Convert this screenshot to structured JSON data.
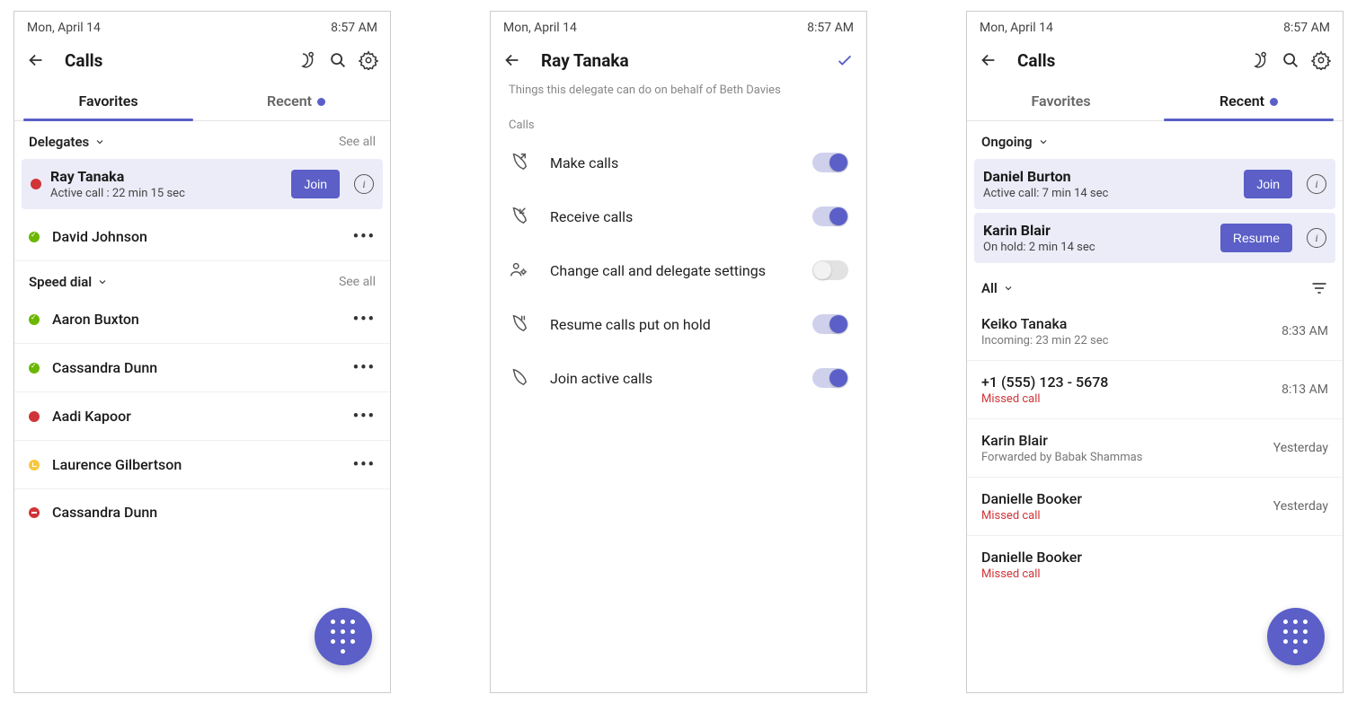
{
  "status": {
    "date": "Mon, April 14",
    "time": "8:57 AM"
  },
  "screen1": {
    "title": "Calls",
    "tabs": {
      "favorites": "Favorites",
      "recent": "Recent"
    },
    "sections": {
      "delegates": "Delegates",
      "speed_dial": "Speed dial",
      "see_all": "See all"
    },
    "active_call": {
      "name": "Ray Tanaka",
      "status": "Active call : 22 min 15 sec",
      "join": "Join"
    },
    "list": {
      "delegate1": "David Johnson",
      "sd1": "Aaron Buxton",
      "sd2": "Cassandra Dunn",
      "sd3": "Aadi Kapoor",
      "sd4": "Laurence Gilbertson",
      "sd5": "Cassandra Dunn"
    }
  },
  "screen2": {
    "title": "Ray Tanaka",
    "desc": "Things this delegate can do on behalf of Beth Davies",
    "calls_label": "Calls",
    "perms": {
      "make": "Make calls",
      "receive": "Receive calls",
      "change": "Change call and delegate settings",
      "resume": "Resume calls put on hold",
      "join": "Join active calls"
    }
  },
  "screen3": {
    "title": "Calls",
    "tabs": {
      "favorites": "Favorites",
      "recent": "Recent"
    },
    "ongoing_label": "Ongoing",
    "all_label": "All",
    "ongoing1": {
      "name": "Daniel Burton",
      "status": "Active call: 7 min 14 sec",
      "btn": "Join"
    },
    "ongoing2": {
      "name": "Karin Blair",
      "status": "On hold: 2 min 14 sec",
      "btn": "Resume"
    },
    "recent1": {
      "name": "Keiko Tanaka",
      "sub": "Incoming: 23 min 22 sec",
      "time": "8:33 AM"
    },
    "recent2": {
      "name": "+1 (555) 123 - 5678",
      "sub": "Missed call",
      "time": "8:13 AM"
    },
    "recent3": {
      "name": "Karin Blair",
      "sub": "Forwarded by Babak Shammas",
      "time": "Yesterday"
    },
    "recent4": {
      "name": "Danielle Booker",
      "sub": "Missed call",
      "time": "Yesterday"
    },
    "recent5": {
      "name": "Danielle Booker",
      "sub": "Missed call",
      "time": ""
    }
  }
}
